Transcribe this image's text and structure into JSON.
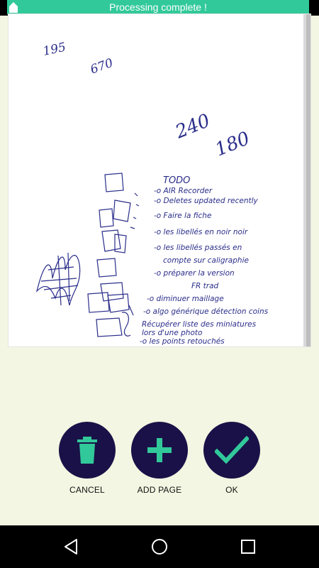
{
  "toast": {
    "message": "Processing complete !",
    "color": "#32c99a"
  },
  "document": {
    "content": "handwritten-scan",
    "handwriting": {
      "numbers": [
        "195",
        "670",
        "240",
        "180"
      ],
      "todo_lines": [
        "TODO",
        "-o AIR Recorder",
        "-o Deletes updated recently",
        "-o Faire la fiche",
        "-o les libellés en noir noir",
        "-o les libellés passés en",
        "compte sur caligraphie",
        "-o préparer la version",
        "FR trad",
        "-o diminuer maillage",
        "-o algo générique détection coins",
        "Récupérer liste des miniatures",
        "lors d'une photo",
        "-o les points retouchés"
      ]
    }
  },
  "actions": [
    {
      "label": "CANCEL",
      "icon": "trash-icon"
    },
    {
      "label": "ADD PAGE",
      "icon": "plus-icon"
    },
    {
      "label": "OK",
      "icon": "check-icon"
    }
  ],
  "colors": {
    "button_bg": "#1a1148",
    "icon_accent": "#32c99a",
    "page_bg": "#f3f6e2",
    "ink": "#2a2d8a"
  },
  "nav": [
    "back-icon",
    "home-icon",
    "recents-icon"
  ]
}
